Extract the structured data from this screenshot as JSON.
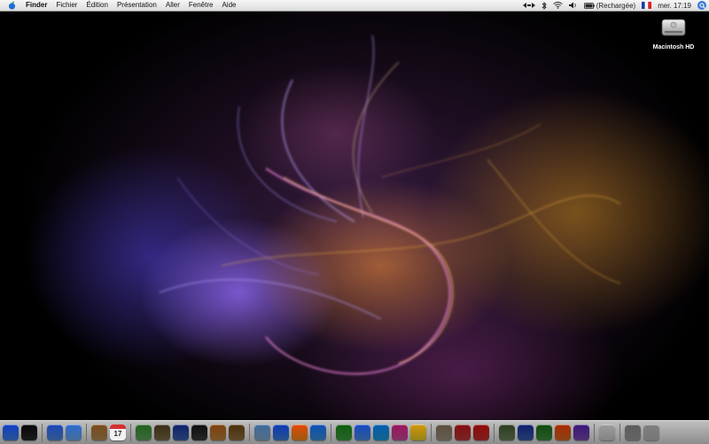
{
  "menubar": {
    "app_name": "Finder",
    "menus": [
      "Fichier",
      "Édition",
      "Présentation",
      "Aller",
      "Fenêtre",
      "Aide"
    ],
    "battery_status": "(Rechargée)",
    "clock": "mer. 17:19"
  },
  "desktop": {
    "drive_label": "Macintosh HD"
  },
  "dock": {
    "calendar_day": "17",
    "icons": [
      {
        "name": "finder-icon",
        "color": "#3f7fe0"
      },
      {
        "name": "dashboard-icon",
        "color": "#2a2a2a"
      },
      {
        "sep": true
      },
      {
        "name": "mail-icon",
        "color": "#4f86d8"
      },
      {
        "name": "safari-icon",
        "color": "#6aa6e6"
      },
      {
        "sep": true
      },
      {
        "name": "address-book-icon",
        "color": "#b08a55"
      },
      {
        "name": "ical-icon",
        "color": "#e9e9e9"
      },
      {
        "sep": true
      },
      {
        "name": "itunes-icon",
        "color": "#5e9e5a"
      },
      {
        "name": "iphoto-icon",
        "color": "#7a6a4a"
      },
      {
        "name": "imovie-icon",
        "color": "#3a5fa8"
      },
      {
        "name": "idvd-icon",
        "color": "#3a3a3a"
      },
      {
        "name": "garageband-icon",
        "color": "#b5813c"
      },
      {
        "name": "iweb-icon",
        "color": "#8c6d3d"
      },
      {
        "sep": true
      },
      {
        "name": "preview-icon",
        "color": "#7fa6c9"
      },
      {
        "name": "internet-explorer-icon",
        "color": "#3c7bd8"
      },
      {
        "name": "vlc-icon",
        "color": "#f08a1c"
      },
      {
        "name": "quicktime-icon",
        "color": "#3c8fd8"
      },
      {
        "sep": true
      },
      {
        "name": "messenger-icon",
        "color": "#3e9a3e"
      },
      {
        "name": "ichat-icon",
        "color": "#4a8ae0"
      },
      {
        "name": "skype-icon",
        "color": "#1d9ad6"
      },
      {
        "name": "adium-icon",
        "color": "#c84a9a"
      },
      {
        "name": "cyberduck-icon",
        "color": "#e6c62a"
      },
      {
        "sep": true
      },
      {
        "name": "utility-app-icon",
        "color": "#9a8e7e"
      },
      {
        "name": "photo-app-icon",
        "color": "#b83a3a"
      },
      {
        "name": "flashcard-app-icon",
        "color": "#c03030"
      },
      {
        "sep": true
      },
      {
        "name": "truck-app-icon",
        "color": "#6a7e5a"
      },
      {
        "name": "word-icon",
        "color": "#3a5aa8"
      },
      {
        "name": "excel-icon",
        "color": "#3e8a3e"
      },
      {
        "name": "powerpoint-icon",
        "color": "#d0681f"
      },
      {
        "name": "entourage-icon",
        "color": "#7a4ab0"
      },
      {
        "sep": true
      },
      {
        "name": "downloads-stack-icon",
        "color": "#c8c8c8"
      },
      {
        "sep": true
      },
      {
        "name": "system-prefs-icon",
        "color": "#9a9a9a"
      },
      {
        "name": "trash-icon",
        "color": "#b5b5b5"
      }
    ]
  }
}
